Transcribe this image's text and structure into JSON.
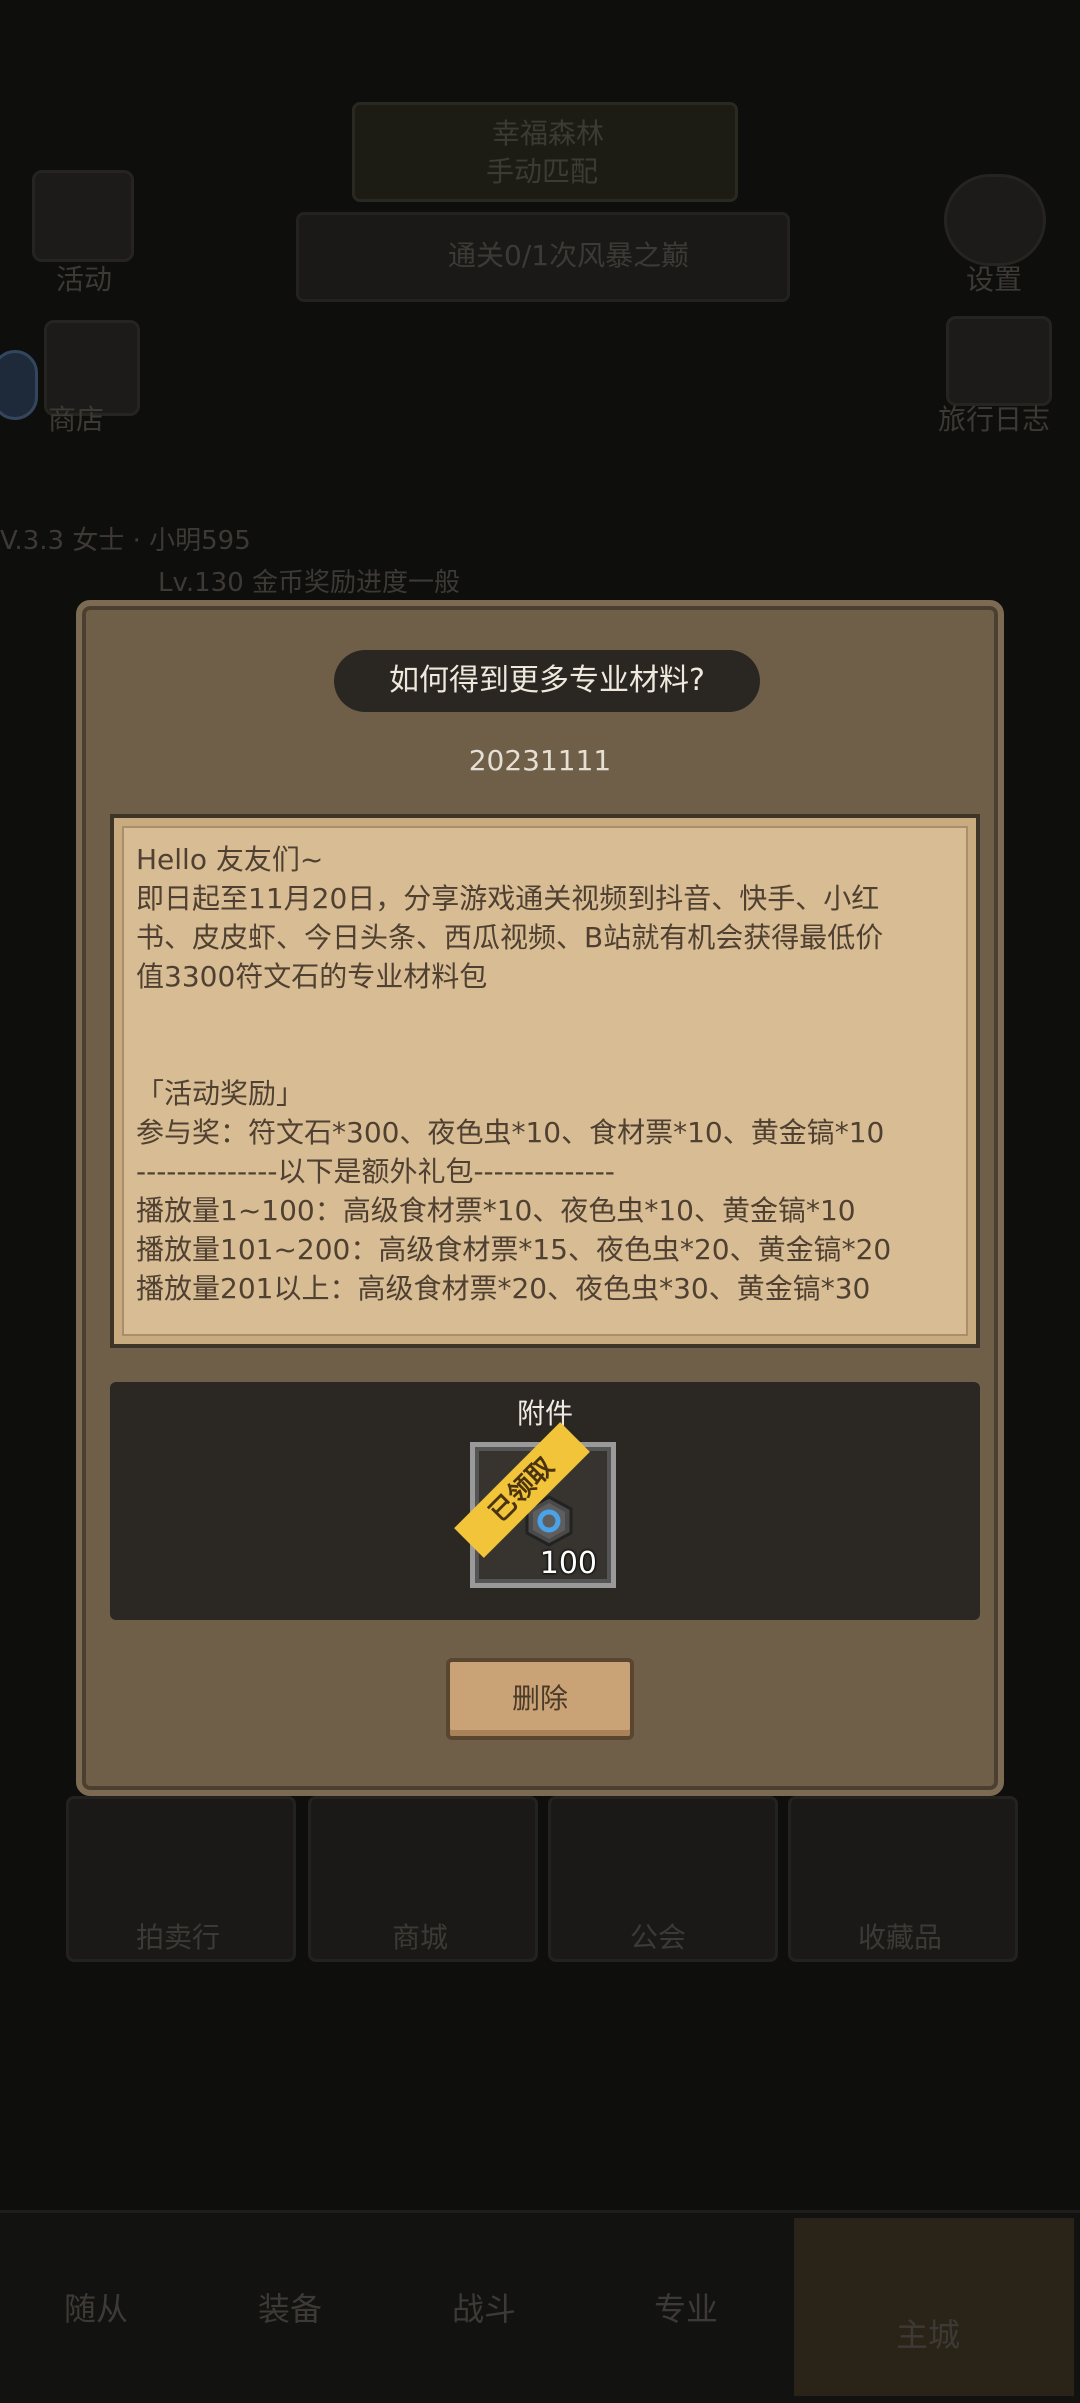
{
  "background": {
    "top_banner_1": "幸福森林",
    "top_banner_2": "手动匹配",
    "quest_text": "通关0/1次风暴之巅",
    "left_icon_1_label": "活动",
    "left_icon_2_label": "商店",
    "right_icon_1_label": "设置",
    "right_icon_2_label": "旅行日志",
    "player_line": "V.3.3 女士 · 小明595",
    "chat_line": "Lv.130 金币奖励进度一般",
    "grid_labels": [
      "拍卖行",
      "商城",
      "公会",
      "收藏品"
    ],
    "nav_tabs": [
      "随从",
      "装备",
      "战斗",
      "专业",
      "主城"
    ]
  },
  "modal": {
    "title": "如何得到更多专业材料?",
    "date": "20231111",
    "letter_lines": [
      "Hello 友友们~",
      "即日起至11月20日，分享游戏通关视频到抖音、快手、小红",
      "书、皮皮虾、今日头条、西瓜视频、B站就有机会获得最低价",
      "值3300符文石的专业材料包",
      "",
      "",
      "「活动奖励」",
      "参与奖：符文石*300、夜色虫*10、食材票*10、黄金镐*10",
      "--------------以下是额外礼包--------------",
      "播放量1~100：高级食材票*10、夜色虫*10、黄金镐*10",
      "播放量101~200：高级食材票*15、夜色虫*20、黄金镐*20",
      "播放量201以上：高级食材票*20、夜色虫*30、黄金镐*30"
    ],
    "attachment_label": "附件",
    "attachment_item": {
      "icon": "rune-stone-icon",
      "count": "100",
      "claimed_label": "已领取"
    },
    "delete_label": "删除"
  }
}
